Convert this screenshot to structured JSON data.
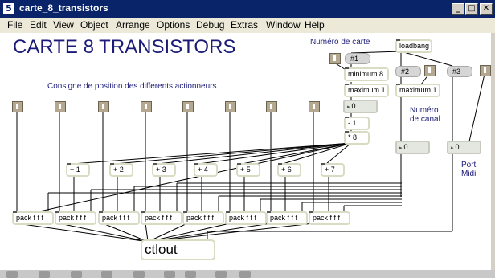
{
  "window": {
    "title": "carte_8_transistors",
    "app_icon_text": "5",
    "controls": {
      "minimize": "_",
      "maximize": "□",
      "close": "✕"
    }
  },
  "menu": [
    "File",
    "Edit",
    "View",
    "Object",
    "Arrange",
    "Options",
    "Debug",
    "Extras",
    "Window",
    "Help"
  ],
  "patch": {
    "heading": "CARTE 8 TRANSISTORS",
    "comments": {
      "consigne": "Consigne de position des differents actionneurs",
      "numero_carte": "Numéro de carte",
      "numero_canal_1": "Numéro",
      "numero_canal_2": "de canal",
      "port_midi_1": "Port",
      "port_midi_2": "Midi"
    },
    "objects": {
      "loadbang": "loadbang",
      "msg1": "#1",
      "msg2": "#2",
      "msg3": "#3",
      "minimum": "minimum 8",
      "maximum_a": "maximum 1",
      "maximum_b": "maximum 1",
      "num_carte": "0.",
      "minus1": "- 1",
      "times8": "* 8",
      "num_canal": "0.",
      "num_port": "0.",
      "plus": [
        "+ 1",
        "+ 2",
        "+ 3",
        "+ 4",
        "+ 5",
        "+ 6",
        "+ 7"
      ],
      "pack": [
        "pack f f f",
        "pack f f f",
        "pack f f f",
        "pack f f f",
        "pack f f f",
        "pack f f f",
        "pack f f f",
        "pack f f f"
      ],
      "ctlout": "ctlout"
    }
  },
  "colors": {
    "accent": "#1c1c78",
    "titlebar": "#0a246a",
    "toggle": "#b4a890"
  }
}
